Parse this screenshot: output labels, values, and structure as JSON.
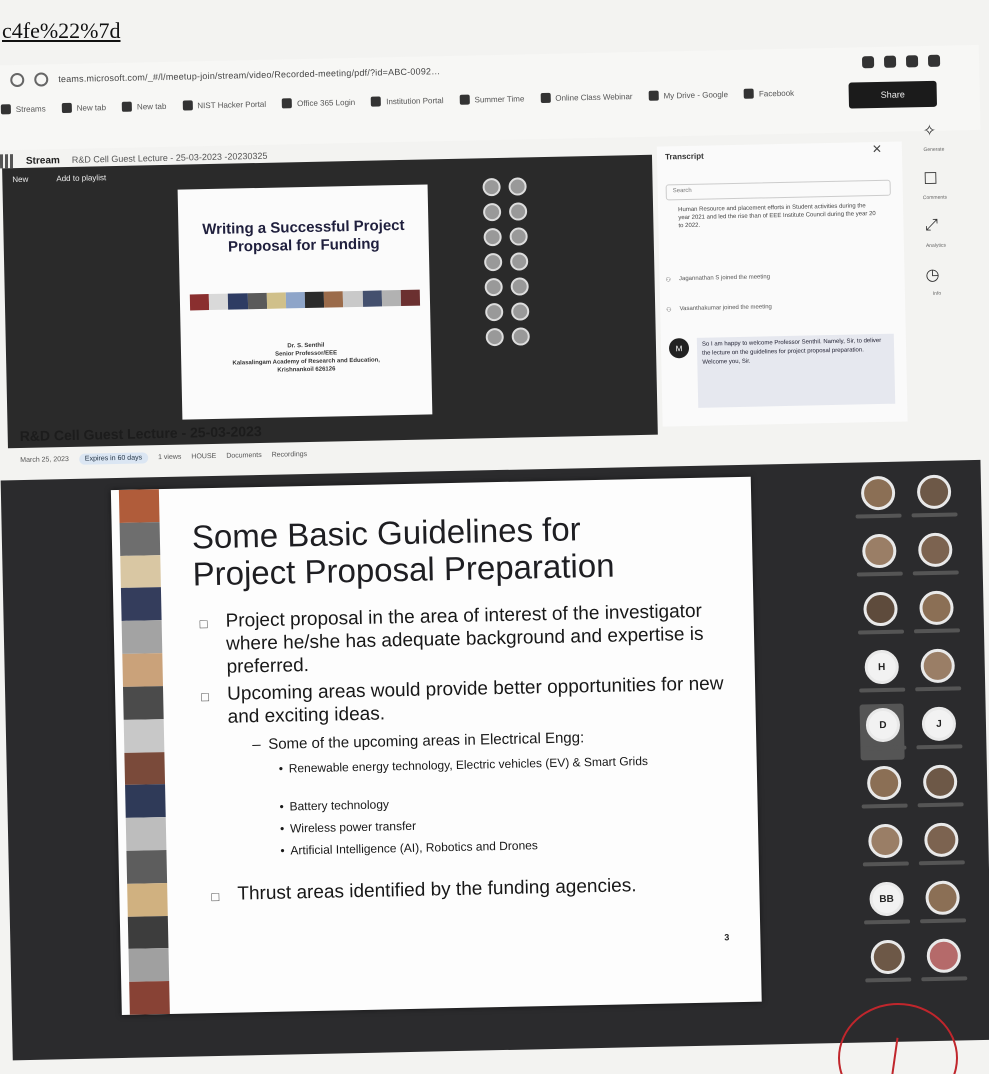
{
  "url_fragment": "c4fe%22%7d",
  "browser": {
    "address": "teams.microsoft.com/_#/l/meetup-join/stream/video/Recorded-meeting/pdf/?id=ABC-0092…",
    "bookmarks": [
      {
        "label": "Streams"
      },
      {
        "label": "New tab"
      },
      {
        "label": "New tab"
      },
      {
        "label": "NIST Hacker Portal"
      },
      {
        "label": "Office 365 Login"
      },
      {
        "label": "Institution Portal"
      },
      {
        "label": "Summer Time"
      },
      {
        "label": "Online Class Webinar"
      },
      {
        "label": "My Drive - Google"
      },
      {
        "label": "Facebook"
      }
    ],
    "share_label": "Share"
  },
  "stream": {
    "app_name": "Stream",
    "file_title": "R&D Cell Guest Lecture - 25-03-2023 -20230325",
    "new_label": "New",
    "add_playlist_label": "Add to playlist"
  },
  "top_slide": {
    "title": "Writing a Successful Project Proposal for Funding",
    "author_lines": [
      "Dr. S. Senthil",
      "Senior Professor/EEE",
      "Kalasalingam Academy of Research and Education,",
      "Krishnankoil 626126"
    ],
    "stripe_colors": [
      "#8a2f2f",
      "#d9d9d9",
      "#2e3c63",
      "#5a5a5a",
      "#d0c08a",
      "#8ea5c9",
      "#2b2b2b",
      "#9b6b4a",
      "#c9c9c9",
      "#44506e",
      "#b2b2b2",
      "#6b3030"
    ]
  },
  "transcript": {
    "title": "Transcript",
    "search_placeholder": "Search",
    "paragraph": "Human Resource and placement efforts in Student activities during the year 2021 and led the rise than of EEE Institute Council during the year 20 to 2022.",
    "events": [
      {
        "text": "Jagannathan S joined the meeting"
      },
      {
        "text": "Vasanthakumar joined the meeting"
      }
    ],
    "message_initial": "M",
    "message": "So I am happy to welcome Professor Senthil. Namely, Sir, to deliver the lecture on the guidelines for project proposal preparation. Welcome you, Sir."
  },
  "right_rail": [
    {
      "icon": "✧",
      "label": "Generate"
    },
    {
      "icon": "☐",
      "label": "Comments"
    },
    {
      "icon": "⤢",
      "label": "Analytics"
    },
    {
      "icon": "◷",
      "label": "Info"
    }
  ],
  "lecture": {
    "title": "R&D Cell Guest Lecture - 25-03-2023",
    "date": "March 25, 2023",
    "expiry": "Expires in 60 days",
    "views": "1 views",
    "org": "HOUSE",
    "extra1": "Documents",
    "extra2": "Recordings"
  },
  "main_slide": {
    "title_line1": "Some Basic Guidelines for",
    "title_line2": "Project Proposal Preparation",
    "bullet1": "Project proposal in the area of interest of the investigator where he/she has adequate background and expertise is preferred.",
    "bullet2": "Upcoming areas would provide better opportunities for new and exciting ideas.",
    "sub_bullet": "Some of the upcoming areas in Electrical Engg:",
    "items": [
      "Renewable energy technology, Electric vehicles (EV) & Smart Grids",
      "Battery technology",
      "Wireless power transfer",
      "Artificial Intelligence (AI), Robotics and Drones"
    ],
    "bullet3": "Thrust areas identified by the funding agencies.",
    "page_number": "3",
    "strip_colors": [
      "#b05c3a",
      "#6e6e6e",
      "#d9c7a3",
      "#343d5c",
      "#a3a3a3",
      "#caa27a",
      "#4b4b4b",
      "#c8c8c8",
      "#7a4a3a",
      "#2f3a58",
      "#bdbdbd",
      "#5d5d5d",
      "#d0b180",
      "#3d3d3d",
      "#a0a0a0",
      "#884235"
    ]
  },
  "participants": [
    {
      "initials": ""
    },
    {
      "initials": ""
    },
    {
      "initials": ""
    },
    {
      "initials": ""
    },
    {
      "initials": ""
    },
    {
      "initials": ""
    },
    {
      "initials": "H"
    },
    {
      "initials": ""
    },
    {
      "initials": "D"
    },
    {
      "initials": "J"
    },
    {
      "initials": ""
    },
    {
      "initials": ""
    },
    {
      "initials": ""
    },
    {
      "initials": ""
    },
    {
      "initials": "BB"
    },
    {
      "initials": ""
    },
    {
      "initials": ""
    },
    {
      "initials": ""
    }
  ],
  "annotation_color": "#c0262c"
}
